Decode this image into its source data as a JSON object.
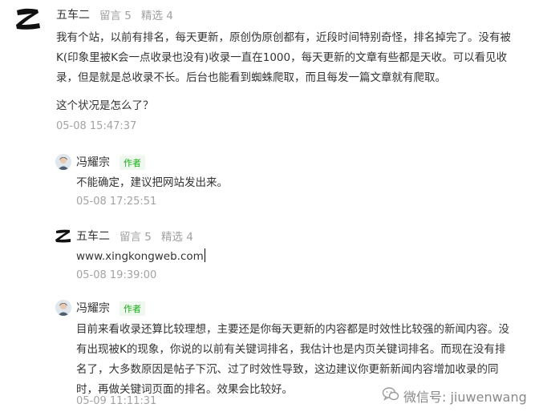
{
  "c1": {
    "user": "五车二",
    "comments": "留言 5",
    "picks": "精选 4",
    "lines": [
      "我有个站，以前有排名，每天更新，原创伪原创都有，近段时间特别奇怪，排名掉完了。没有被",
      "K(印象里被K会一点收录也没有)收录一直在1000，每天更新的文章有些都是天收。可以看见收",
      "录，但是就是总收录不长。后台也能看到蜘蛛爬取，而且每发一篇文章就有爬取。"
    ],
    "question": "这个状况是怎么了？",
    "time": "05-08 15:47:37"
  },
  "r1": {
    "user": "冯耀宗",
    "badge": "作者",
    "text": "不能确定，建议把网站发出来。",
    "time": "05-08 17:25:51"
  },
  "c2": {
    "user": "五车二",
    "comments": "留言 5",
    "picks": "精选 4",
    "text": "www.xingkongweb.com",
    "time": "05-08 19:39:00"
  },
  "r2": {
    "user": "冯耀宗",
    "badge": "作者",
    "lines": [
      "目前来看收录还算比较理想，主要还是你每天更新的内容都是时效性比较强的新闻内容。没",
      "有出现被K的现象，你说的以前有关键词排名，我估计也是内页关键词排名。而现在没有排",
      "名了，大多数原因是帖子下沉、过了时效性导致，这边建议你更新新闻内容增加收录的同",
      "时，再做关键词页面的排名。效果会比较好。"
    ],
    "time": "05-09 11:11:31"
  },
  "watermark": {
    "text": "微信号: jiuwenwang"
  }
}
